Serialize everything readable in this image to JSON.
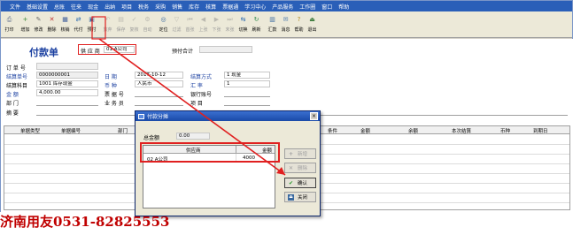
{
  "menu": [
    "文件",
    "基础设置",
    "总账",
    "往来",
    "现金",
    "出纳",
    "项目",
    "税务",
    "采购",
    "销售",
    "库存",
    "核算",
    "票据通",
    "学习中心",
    "产品服务",
    "工作圈",
    "窗口",
    "帮助"
  ],
  "toolbar": [
    {
      "label": "打印",
      "icon": "printer-icon",
      "glyph": "⎙",
      "color": "#5a6a8a",
      "enabled": true
    },
    {
      "label": "增加",
      "icon": "add-icon",
      "glyph": "+",
      "color": "#3a8a3a",
      "enabled": true
    },
    {
      "label": "修改",
      "icon": "edit-icon",
      "glyph": "✎",
      "color": "#6a6a6a",
      "enabled": true
    },
    {
      "label": "删除",
      "icon": "delete-icon",
      "glyph": "✕",
      "color": "#c03030",
      "enabled": true
    },
    {
      "label": "核销",
      "icon": "verify-icon",
      "glyph": "▦",
      "color": "#3a5a9a",
      "enabled": true
    },
    {
      "label": "代付",
      "icon": "proxy-pay-icon",
      "glyph": "⇄",
      "color": "#2a6ab0",
      "enabled": true
    },
    {
      "label": "预付",
      "icon": "prepay-icon",
      "glyph": "▣",
      "color": "#3a6aa0",
      "enabled": true
    },
    {
      "label": "放弃",
      "icon": "discard-icon",
      "glyph": "↶",
      "color": "#808080",
      "enabled": false
    },
    {
      "label": "保存",
      "icon": "save-icon",
      "glyph": "▤",
      "color": "#808080",
      "enabled": false
    },
    {
      "label": "复核",
      "icon": "review-icon",
      "glyph": "✓",
      "color": "#808080",
      "enabled": false
    },
    {
      "label": "自动",
      "icon": "auto-icon",
      "glyph": "⚙",
      "color": "#808080",
      "enabled": false
    },
    {
      "label": "定位",
      "icon": "locate-icon",
      "glyph": "◎",
      "color": "#3a6aa0",
      "enabled": true
    },
    {
      "label": "过滤",
      "icon": "filter-icon",
      "glyph": "▽",
      "color": "#808080",
      "enabled": false
    },
    {
      "label": "首张",
      "icon": "first-icon",
      "glyph": "⏮",
      "color": "#808080",
      "enabled": false
    },
    {
      "label": "上张",
      "icon": "prev-icon",
      "glyph": "◀",
      "color": "#808080",
      "enabled": false
    },
    {
      "label": "下张",
      "icon": "next-icon",
      "glyph": "▶",
      "color": "#808080",
      "enabled": false
    },
    {
      "label": "末张",
      "icon": "last-icon",
      "glyph": "⏭",
      "color": "#808080",
      "enabled": false
    },
    {
      "label": "切换",
      "icon": "switch-icon",
      "glyph": "⇆",
      "color": "#2a6ab0",
      "enabled": true
    },
    {
      "label": "刷新",
      "icon": "refresh-icon",
      "glyph": "↻",
      "color": "#2a8a4a",
      "enabled": true
    },
    {
      "label": "汇款",
      "icon": "remit-icon",
      "glyph": "▥",
      "color": "#3a6aa0",
      "enabled": true
    },
    {
      "label": "消息",
      "icon": "message-icon",
      "glyph": "✉",
      "color": "#4a7ab0",
      "enabled": true
    },
    {
      "label": "帮助",
      "icon": "help-icon",
      "glyph": "?",
      "color": "#b08a20",
      "enabled": true
    },
    {
      "label": "退出",
      "icon": "exit-icon",
      "glyph": "⏏",
      "color": "#3a7a3a",
      "enabled": true
    }
  ],
  "form": {
    "title": "付款单",
    "vendor_label": "供 应 商",
    "vendor_value": "01  A公司",
    "prepay_total_label": "预付合计",
    "doc_no_label": "订 单 号",
    "settle_no_label": "结算单号",
    "settle_no_value": "0000000001",
    "settle_subject_label": "结算科目",
    "settle_subject_value": "1001  库存现金",
    "amount_label": "金    额",
    "amount_value": "4,000.00",
    "dept_label": "部    门",
    "summary_label": "摘    要",
    "date_label": "日    期",
    "date_value": "2017-10-12",
    "currency_label": "币    种",
    "currency_value": "人民币",
    "bill_no_label": "票 据 号",
    "salesman_label": "业 务 员",
    "settle_method_label": "结算方式",
    "settle_method_value": "1   现金",
    "exchange_label": "汇    率",
    "exchange_value": "1",
    "bank_account_label": "银行账号",
    "project_label": "项    目"
  },
  "grid": {
    "headers": [
      "单据类型",
      "单据编号",
      "部门",
      "条件",
      "金额",
      "余额",
      "本次结算",
      "币种",
      "到期日"
    ]
  },
  "dialog": {
    "title": "付款分摊",
    "close_glyph": "×",
    "total_label": "总金额",
    "total_value": "0.00",
    "col_vendor": "供应商",
    "col_amount": "金额",
    "row_vendor": "02  A公司",
    "row_amount": "4000",
    "btn_add": "新增",
    "btn_delete": "删除",
    "btn_ok": "确认",
    "btn_close": "关闭"
  },
  "watermark": "济南用友0531-82825553"
}
